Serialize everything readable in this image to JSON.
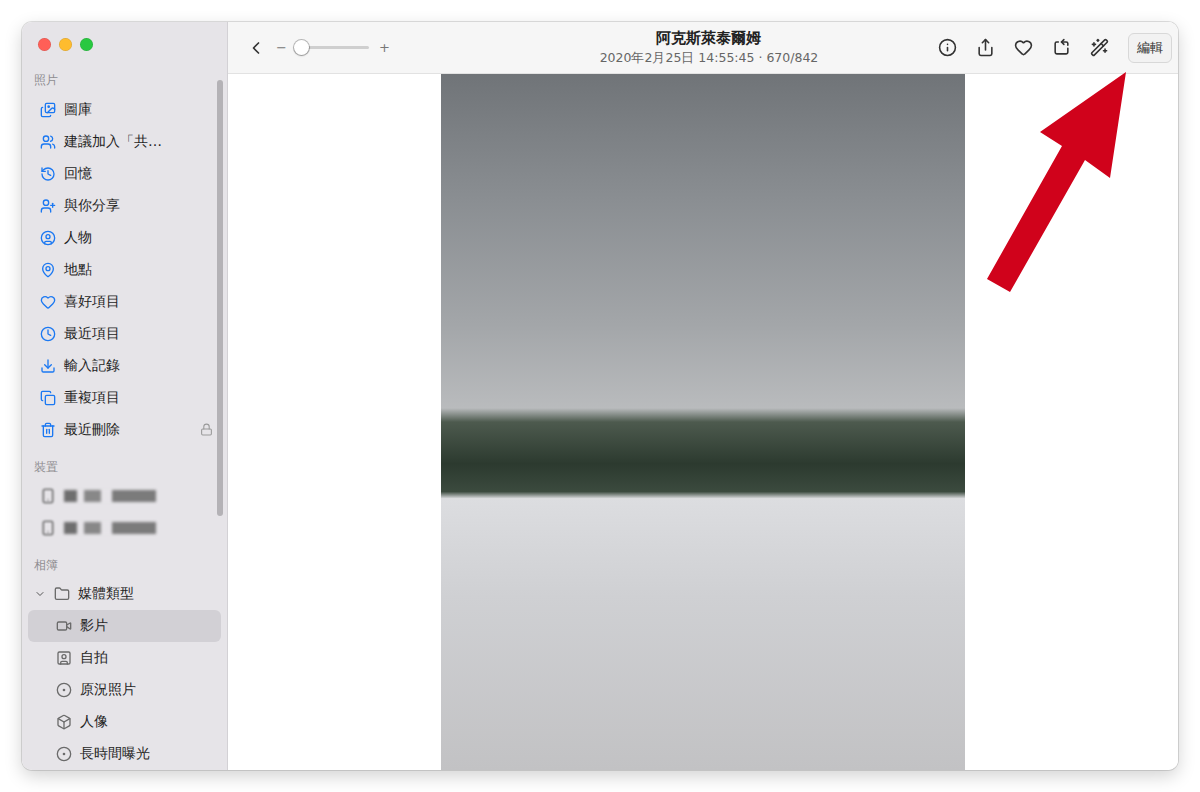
{
  "window": {
    "title": "阿克斯萊泰爾姆",
    "subtitle": "2020年2月25日 14:55:45 · 670/842"
  },
  "toolbar": {
    "zoom_minus": "−",
    "zoom_plus": "+",
    "zoom": {
      "level": 0.05
    },
    "edit_button": "編輯",
    "favorite": false
  },
  "sidebar": {
    "sections": [
      {
        "title": "照片",
        "items": [
          {
            "label": "圖庫",
            "selected": false,
            "locked": false
          },
          {
            "label": "建議加入「共…",
            "selected": false,
            "locked": false
          },
          {
            "label": "回憶",
            "selected": false,
            "locked": false
          },
          {
            "label": "與你分享",
            "selected": false,
            "locked": false
          },
          {
            "label": "人物",
            "selected": false,
            "locked": false
          },
          {
            "label": "地點",
            "selected": false,
            "locked": false
          },
          {
            "label": "喜好項目",
            "selected": false,
            "locked": false
          },
          {
            "label": "最近項目",
            "selected": false,
            "locked": false
          },
          {
            "label": "輸入記錄",
            "selected": false,
            "locked": false
          },
          {
            "label": "重複項目",
            "selected": false,
            "locked": false
          },
          {
            "label": "最近刪除",
            "selected": false,
            "locked": true
          }
        ]
      }
    ],
    "devices": {
      "title": "裝置",
      "items": [
        {
          "blurred": true
        },
        {
          "blurred": true
        }
      ]
    },
    "albums": {
      "title": "相簿",
      "group": {
        "label": "媒體類型",
        "expanded": true,
        "items": [
          {
            "label": "影片",
            "selected": true
          },
          {
            "label": "自拍",
            "selected": false
          },
          {
            "label": "原況照片",
            "selected": false
          },
          {
            "label": "人像",
            "selected": false
          },
          {
            "label": "長時間曝光",
            "selected": false
          }
        ]
      }
    }
  }
}
